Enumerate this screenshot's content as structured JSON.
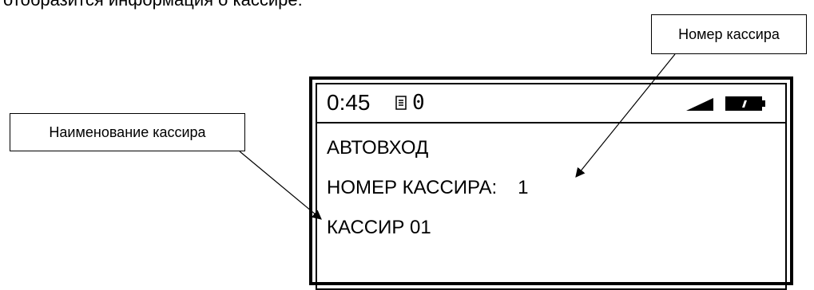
{
  "intro_text": "отобразится информация о кассире:",
  "callouts": {
    "cashier_number": "Номер кассира",
    "cashier_name": "Наименование кассира"
  },
  "display": {
    "clock": "0:45",
    "zero_glyph": "0",
    "line_autologin": "АВТОВХОД",
    "cashier_number_label": "НОМЕР КАССИРА:",
    "cashier_number_value": "1",
    "cashier_name": "КАССИР 01",
    "icons": [
      "document-icon",
      "signal-icon",
      "battery-icon"
    ]
  }
}
